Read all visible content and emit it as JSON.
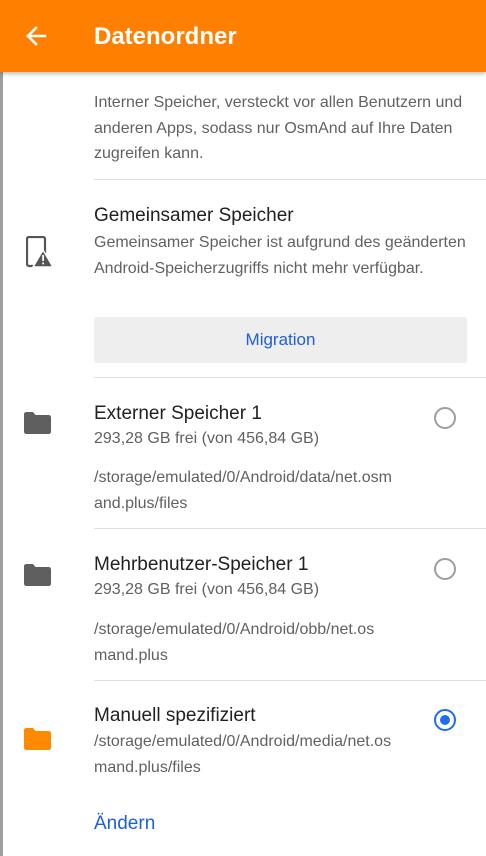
{
  "appbar": {
    "title": "Datenordner",
    "back_icon": "arrow-back-icon",
    "background": "#ff7f00"
  },
  "internal": {
    "description": "Interner Speicher, versteckt vor allen Benutzern und anderen Apps, sodass nur OsmAnd auf Ihre Daten zugreifen kann."
  },
  "shared": {
    "icon": "phone-warning-icon",
    "title": "Gemeinsamer Speicher",
    "description": "Gemeinsamer Speicher ist aufgrund des geänderten Android-Speicherzugriffs nicht mehr verfügbar.",
    "button_label": "Migration"
  },
  "storage_options": [
    {
      "icon": "folder-icon",
      "title": "Externer Speicher 1",
      "free": "293,28 GB frei (von 456,84 GB)",
      "path": "/storage/emulated/0/Android/data/net.osmand.plus/files",
      "selected": false
    },
    {
      "icon": "folder-icon",
      "title": "Mehrbenutzer-Speicher 1",
      "free": "293,28 GB frei (von 456,84 GB)",
      "path": "/storage/emulated/0/Android/obb/net.osmand.plus",
      "selected": false
    },
    {
      "icon": "folder-icon",
      "title": "Manuell spezifiziert",
      "path": "/storage/emulated/0/Android/media/net.osmand.plus/files",
      "selected": true,
      "accent": "#ff8a00"
    }
  ],
  "manual": {
    "change_label": "Ändern"
  },
  "colors": {
    "accent": "#1f6ee9",
    "link": "#1d5fd4"
  }
}
